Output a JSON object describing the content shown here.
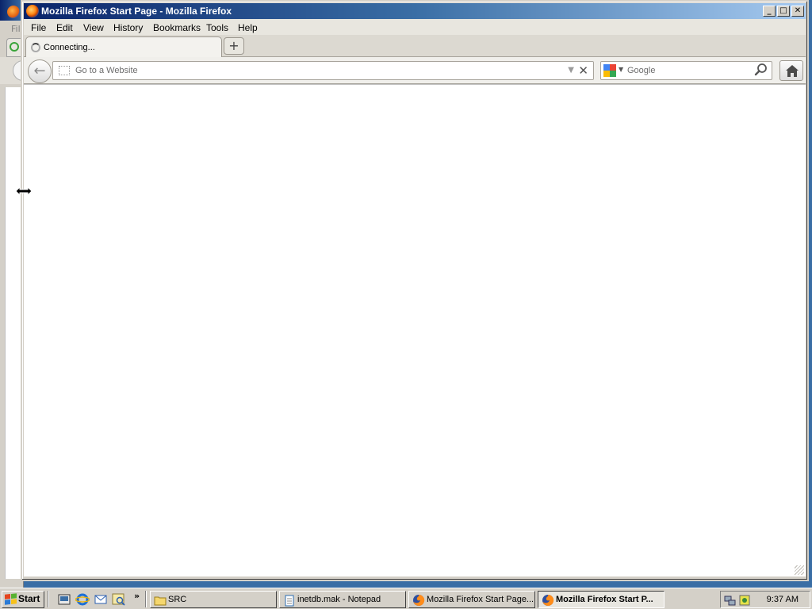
{
  "window": {
    "title": "Mozilla Firefox Start Page - Mozilla Firefox",
    "controls": {
      "minimize": "_",
      "maximize": "□",
      "close": "✕"
    }
  },
  "background_window": {
    "menu_hint": "Fil"
  },
  "menubar": {
    "items": [
      "File",
      "Edit",
      "View",
      "History",
      "Bookmarks",
      "Tools",
      "Help"
    ]
  },
  "tabs": [
    {
      "label": "Connecting...",
      "loading": true
    }
  ],
  "new_tab_label": "+",
  "navbar": {
    "back_glyph": "←",
    "url_value": "",
    "url_placeholder": "Go to a Website",
    "dropmarker": "▼",
    "stop_glyph": "✕",
    "search_placeholder": "Google",
    "search_engine": "Google"
  },
  "taskbar": {
    "start_label": "Start",
    "quicklaunch_more": "»",
    "tasks": [
      {
        "label": "SRC",
        "icon": "folder-icon",
        "active": false
      },
      {
        "label": "inetdb.mak - Notepad",
        "icon": "notepad-icon",
        "active": false
      },
      {
        "label": "Mozilla Firefox Start Page...",
        "icon": "firefox-icon",
        "active": false
      },
      {
        "label": "Mozilla Firefox Start P...",
        "icon": "firefox-icon",
        "active": true
      }
    ],
    "clock": "9:37 AM"
  },
  "colors": {
    "titlebar_start": "#0a246a",
    "titlebar_end": "#a6caf0",
    "desktop": "#3a6ea5",
    "chrome": "#d4d0c8"
  }
}
